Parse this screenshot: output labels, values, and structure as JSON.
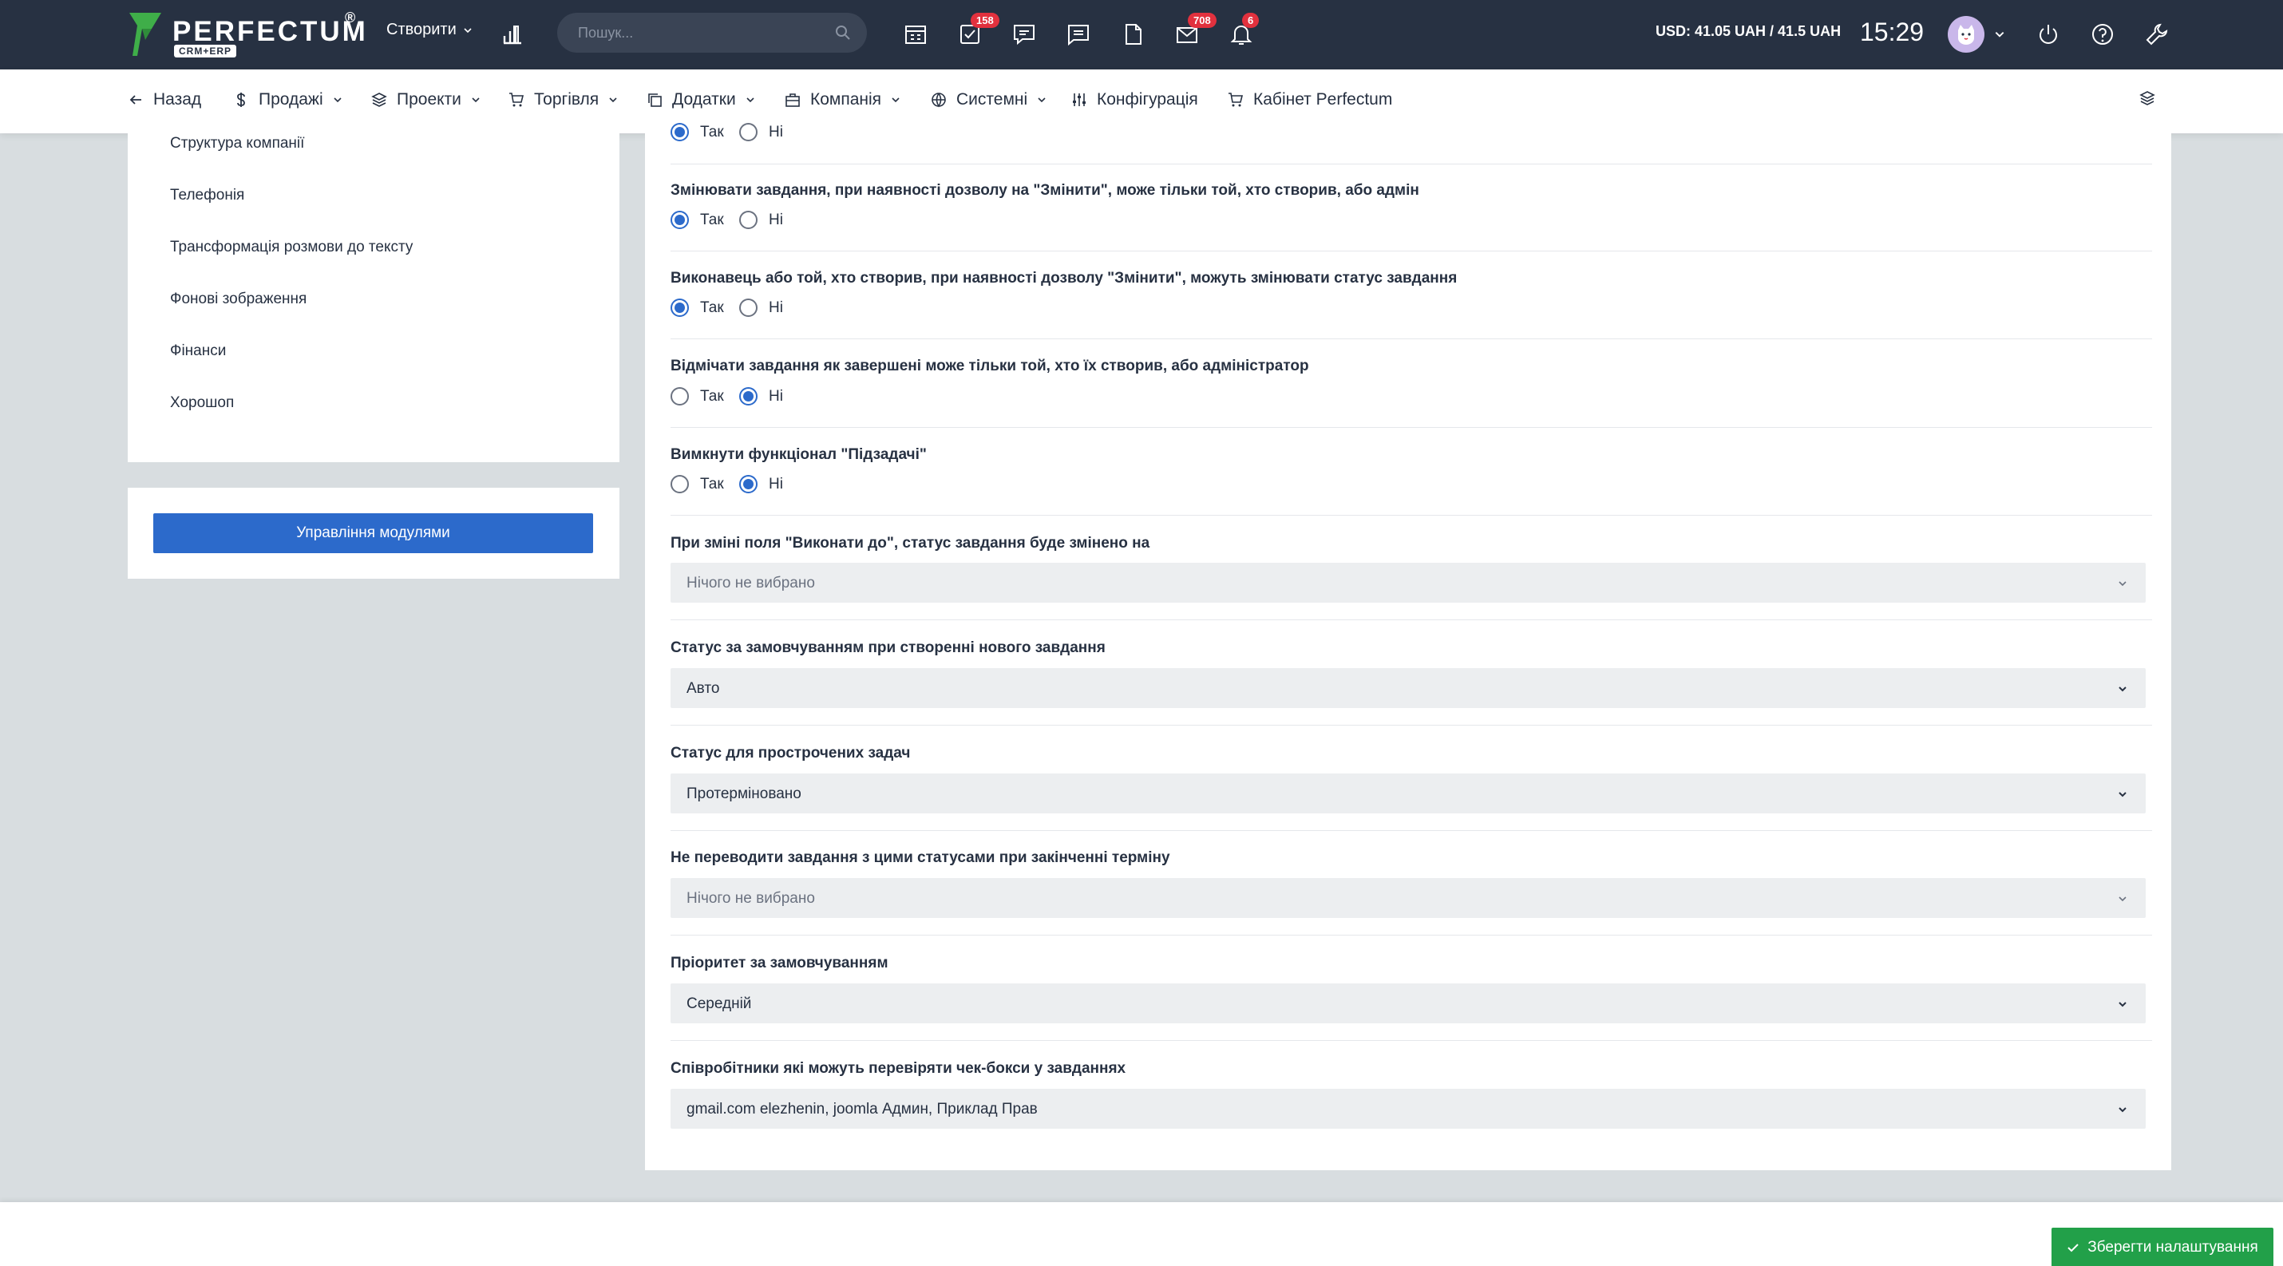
{
  "topbar": {
    "brand": "PERFECTUM",
    "brand_sub": "CRM+ERP",
    "brand_reg": "®",
    "create_label": "Створити",
    "search_placeholder": "Пошук...",
    "badges": {
      "tasks": "158",
      "mail": "708",
      "notifications": "6"
    },
    "currency": "USD: 41.05 UAH / 41.5 UAH",
    "time": "15:29"
  },
  "menu": {
    "back": "Назад",
    "sales": "Продажі",
    "projects": "Проекти",
    "trade": "Торгівля",
    "addons": "Додатки",
    "company": "Компанія",
    "system": "Системні",
    "config": "Конфігурація",
    "cabinet": "Кабінет Perfectum"
  },
  "sidebar": {
    "links": [
      "Структура компанії",
      "Телефонія",
      "Трансформація розмови до тексту",
      "Фонові зображення",
      "Фінанси",
      "Хорошоп"
    ],
    "modules_button": "Управління модулями"
  },
  "settings": {
    "yes": "Так",
    "no": "Ні",
    "q0_selected": "yes",
    "q1": {
      "label": "Змінювати завдання, при наявності дозволу на \"Змінити\", може тільки той, хто створив, або адмін",
      "selected": "yes"
    },
    "q2": {
      "label": "Виконавець або той, хто створив, при наявності дозволу \"Змінити\", можуть змінювати статус завдання",
      "selected": "yes"
    },
    "q3": {
      "label": "Відмічати завдання як завершені може тільки той, хто їх створив, або адміністратор",
      "selected": "no"
    },
    "q4": {
      "label": "Вимкнути функціонал \"Підзадачі\"",
      "selected": "no"
    },
    "s1": {
      "label": "При зміні поля \"Виконати до\", статус завдання буде змінено на",
      "value": "Нічого не вибрано"
    },
    "s2": {
      "label": "Статус за замовчуванням при створенні нового завдання",
      "value": "Авто"
    },
    "s3": {
      "label": "Статус для прострочених задач",
      "value": "Протерміновано"
    },
    "s4": {
      "label": "Не переводити завдання з цими статусами при закінченні терміну",
      "value": "Нічого не вибрано"
    },
    "s5": {
      "label": "Пріоритет за замовчуванням",
      "value": "Середній"
    },
    "s6": {
      "label": "Співробітники які можуть перевіряти чек-бокси у завданнях",
      "value": "gmail.com elezhenin, joomla Админ, Приклад Прав"
    }
  },
  "footer": {
    "save_label": "Зберегти налаштування"
  },
  "colors": {
    "topbar": "#273142",
    "primary": "#2c6acb",
    "save": "#22a049",
    "badge": "#e2313e"
  }
}
